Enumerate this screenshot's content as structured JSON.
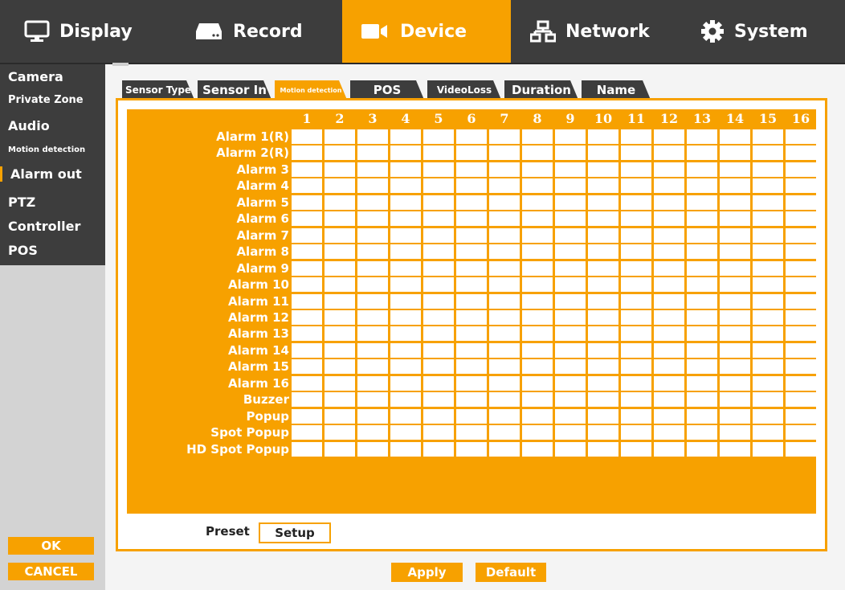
{
  "top_tabs": [
    {
      "label": "Display",
      "icon": "monitor-icon"
    },
    {
      "label": "Record",
      "icon": "hard-drive-icon"
    },
    {
      "label": "Device",
      "icon": "camera-icon",
      "active": true
    },
    {
      "label": "Network",
      "icon": "network-icon"
    },
    {
      "label": "System",
      "icon": "gear-icon"
    }
  ],
  "sidebar": {
    "items": [
      {
        "label": "Camera"
      },
      {
        "label": "Private Zone"
      },
      {
        "label": "Audio"
      },
      {
        "label": "Motion detection"
      },
      {
        "label": "Alarm out",
        "active": true
      },
      {
        "label": "PTZ"
      },
      {
        "label": "Controller"
      },
      {
        "label": "POS"
      }
    ],
    "ok_label": "OK",
    "cancel_label": "CANCEL"
  },
  "sub_tabs": [
    {
      "label": "Sensor Type"
    },
    {
      "label": "Sensor In"
    },
    {
      "label": "Motion detection",
      "active": true
    },
    {
      "label": "POS"
    },
    {
      "label": "VideoLoss"
    },
    {
      "label": "Duration"
    },
    {
      "label": "Name"
    }
  ],
  "grid": {
    "columns": [
      "1",
      "2",
      "3",
      "4",
      "5",
      "6",
      "7",
      "8",
      "9",
      "10",
      "11",
      "12",
      "13",
      "14",
      "15",
      "16"
    ],
    "rows": [
      "Alarm 1(R)",
      "Alarm 2(R)",
      "Alarm 3",
      "Alarm 4",
      "Alarm 5",
      "Alarm 6",
      "Alarm 7",
      "Alarm 8",
      "Alarm 9",
      "Alarm 10",
      "Alarm 11",
      "Alarm 12",
      "Alarm 13",
      "Alarm 14",
      "Alarm 15",
      "Alarm 16",
      "Buzzer",
      "Popup",
      "Spot Popup",
      "HD Spot Popup"
    ]
  },
  "preset_label": "Preset",
  "setup_label": "Setup",
  "apply_label": "Apply",
  "default_label": "Default",
  "colors": {
    "accent": "#f7a100",
    "dark": "#3d3d3d",
    "sidebar_bg": "#d3d3d3"
  }
}
